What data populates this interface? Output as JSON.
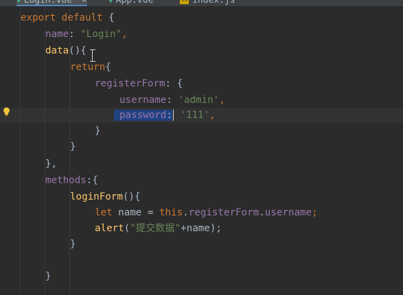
{
  "tabs": [
    {
      "label": "Login.vue",
      "icon": "vue-icon",
      "active": true
    },
    {
      "label": "App.vue",
      "icon": "vue-icon",
      "active": false
    },
    {
      "label": "index.js",
      "icon": "js-file-icon",
      "js_badge": "JS",
      "active": false
    }
  ],
  "code": {
    "l1": {
      "kw1": "export",
      "kw2": "default",
      "rest": " {"
    },
    "l2": {
      "key": "name",
      "colon": ": ",
      "value": "\"Login\"",
      "end": ","
    },
    "l3": {
      "fn": "data",
      "rest": "(){"
    },
    "l4": {
      "kw": "return",
      "rest": "{"
    },
    "l5": {
      "key": "registerForm",
      "rest": ": {"
    },
    "l6": {
      "key": "username",
      "colon": ": ",
      "value": "'admin'",
      "end": ","
    },
    "l7": {
      "key": "password",
      "colon": ":",
      "space": " ",
      "value": "'111'",
      "end": ","
    },
    "l8": {
      "text": "}"
    },
    "l9": {
      "text": "}"
    },
    "l10": {
      "text": "},"
    },
    "l11": {
      "key": "methods",
      "rest": ":{"
    },
    "l12": {
      "fn": "loginForm",
      "rest": "(){"
    },
    "l13": {
      "kw": "let",
      "mid": " name = ",
      "kw2": "this",
      "dot": ".",
      "prop1": "registerForm",
      "dot2": ".",
      "prop2": "username",
      "end": ";"
    },
    "l14": {
      "fn": "alert",
      "open": "(",
      "str": "\"提交数据\"",
      "rest": "+name);"
    },
    "l15": {
      "text": "}"
    },
    "l16": {
      "text": "}"
    }
  },
  "colors": {
    "background": "#2b2b2b",
    "keyword": "#cc7832",
    "string": "#6a8759",
    "property": "#9876aa",
    "function": "#ffc66d",
    "selection": "#214283"
  }
}
